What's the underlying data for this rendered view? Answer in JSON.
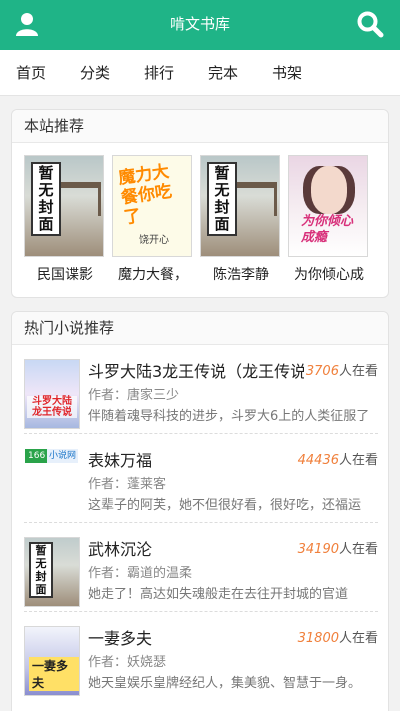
{
  "app": {
    "title": "啃文书库",
    "accent": "#1fb487"
  },
  "icons": {
    "user": "user-icon",
    "search": "search-icon"
  },
  "nav": {
    "tabs": [
      "首页",
      "分类",
      "排行",
      "完本",
      "书架"
    ]
  },
  "recommend": {
    "header": "本站推荐",
    "books": [
      {
        "title": "民国谍影",
        "cover_text": "暂无封面"
      },
      {
        "title": "魔力大餐，",
        "cover_text": "魔力大餐你吃了",
        "cover_author": "饶开心"
      },
      {
        "title": "陈浩李静",
        "cover_text": "暂无封面"
      },
      {
        "title": "为你倾心成",
        "cover_text": "为你倾心成瘾"
      }
    ]
  },
  "hot": {
    "header": "热门小说推荐",
    "reading_suffix": "人在看",
    "author_prefix": "作者：",
    "items": [
      {
        "title": "斗罗大陆3龙王传说（龙王传说）",
        "count": "3706",
        "author": "唐家三少",
        "desc": "伴随着魂导科技的进步，斗罗大6上的人类征服了",
        "cover_text": "斗罗大陆 龙王传说"
      },
      {
        "title": "表妹万福",
        "count": "44436",
        "author": "蓬莱客",
        "desc": "这辈子的阿芙，她不但很好看，很好吃，还福运",
        "cover_logo": "166",
        "cover_logo2": "小说网"
      },
      {
        "title": "武林沉沦",
        "count": "34190",
        "author": "霸道的温柔",
        "desc": "她走了！高达如失魂般走在去往开封城的官道",
        "cover_text": "暂无封面"
      },
      {
        "title": "一妻多夫",
        "count": "31800",
        "author": "妖娆瑟",
        "desc": "她天皇娱乐皇牌经纪人，集美貌、智慧于一身。",
        "cover_text": "一妻多夫"
      }
    ]
  }
}
